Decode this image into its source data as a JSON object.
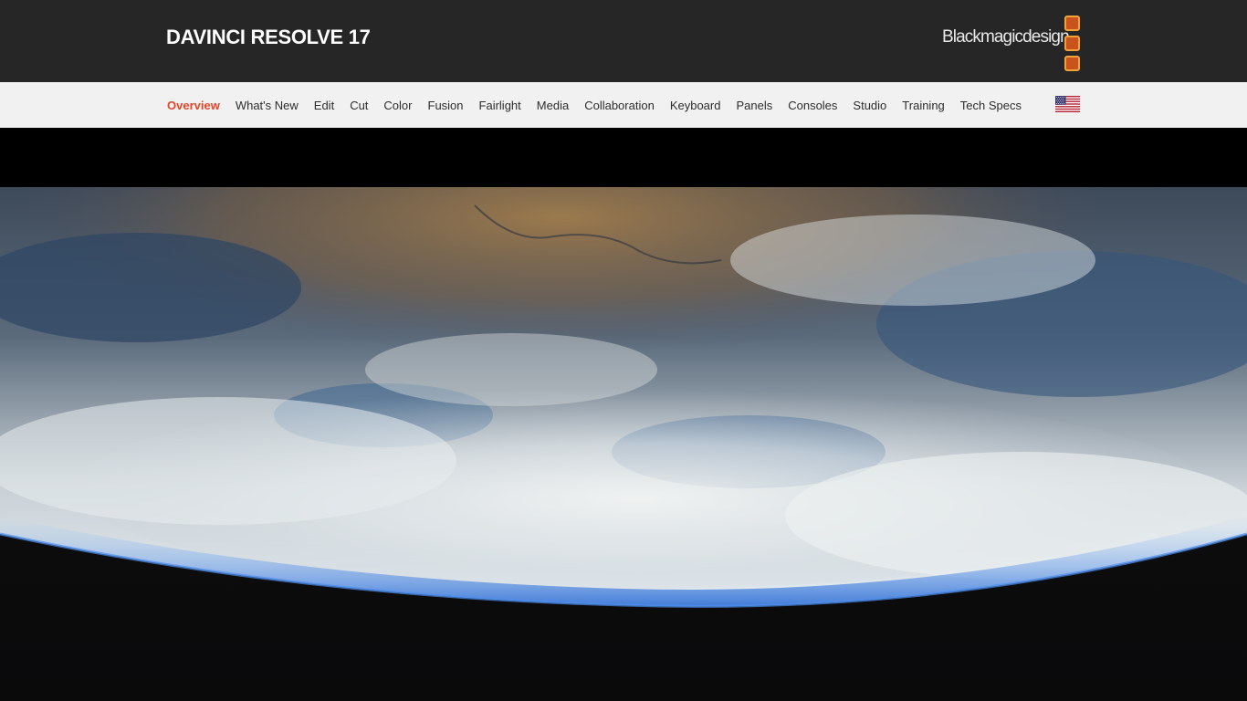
{
  "header": {
    "product_title": "DAVINCI RESOLVE 17",
    "brand_name": "Blackmagicdesign",
    "brand_colors": {
      "square_fill": "#c8531d",
      "square_border": "#f2a23a"
    }
  },
  "nav": {
    "active_color": "#e2462b",
    "items": [
      {
        "label": "Overview",
        "active": true
      },
      {
        "label": "What's New",
        "active": false
      },
      {
        "label": "Edit",
        "active": false
      },
      {
        "label": "Cut",
        "active": false
      },
      {
        "label": "Color",
        "active": false
      },
      {
        "label": "Fusion",
        "active": false
      },
      {
        "label": "Fairlight",
        "active": false
      },
      {
        "label": "Media",
        "active": false
      },
      {
        "label": "Collaboration",
        "active": false
      },
      {
        "label": "Keyboard",
        "active": false
      },
      {
        "label": "Panels",
        "active": false
      },
      {
        "label": "Consoles",
        "active": false
      },
      {
        "label": "Studio",
        "active": false
      },
      {
        "label": "Training",
        "active": false
      },
      {
        "label": "Tech Specs",
        "active": false
      }
    ],
    "region_icon": "us-flag-icon"
  },
  "hero": {
    "image": "earth-from-orbit"
  }
}
